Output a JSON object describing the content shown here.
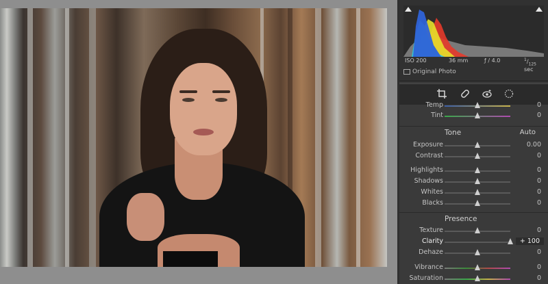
{
  "histogram": {
    "iso": "ISO 200",
    "focal_length": "36 mm",
    "aperture": "ƒ / 4.0",
    "shutter_num": "1",
    "shutter_den": "125",
    "shutter_unit": "sec",
    "original_photo_label": "Original Photo",
    "colors": {
      "blue": "#2f63d8",
      "cyan": "#2fc9d8",
      "yellow": "#e6e02a",
      "red": "#e63a2a",
      "gray": "#9a9a9a"
    }
  },
  "tools": [
    {
      "icon": "crop-icon"
    },
    {
      "icon": "healing-icon"
    },
    {
      "icon": "red-eye-icon"
    },
    {
      "icon": "mask-icon"
    }
  ],
  "basic": {
    "temp": {
      "label": "Temp",
      "value": "0",
      "level": 0.5
    },
    "tint": {
      "label": "Tint",
      "value": "0",
      "level": 0.5
    }
  },
  "tone": {
    "title": "Tone",
    "auto": "Auto",
    "rows": [
      {
        "label": "Exposure",
        "value": "0.00",
        "level": 0.5
      },
      {
        "label": "Contrast",
        "value": "0",
        "level": 0.5
      },
      {
        "label": "Highlights",
        "value": "0",
        "level": 0.5
      },
      {
        "label": "Shadows",
        "value": "0",
        "level": 0.5
      },
      {
        "label": "Whites",
        "value": "0",
        "level": 0.5
      },
      {
        "label": "Blacks",
        "value": "0",
        "level": 0.5
      }
    ]
  },
  "presence": {
    "title": "Presence",
    "rows": [
      {
        "label": "Texture",
        "value": "0",
        "level": 0.5
      },
      {
        "label": "Clarity",
        "value": "+ 100",
        "level": 1.0
      },
      {
        "label": "Dehaze",
        "value": "0",
        "level": 0.5
      },
      {
        "label": "Vibrance",
        "value": "0",
        "level": 0.5
      },
      {
        "label": "Saturation",
        "value": "0",
        "level": 0.5
      }
    ]
  }
}
